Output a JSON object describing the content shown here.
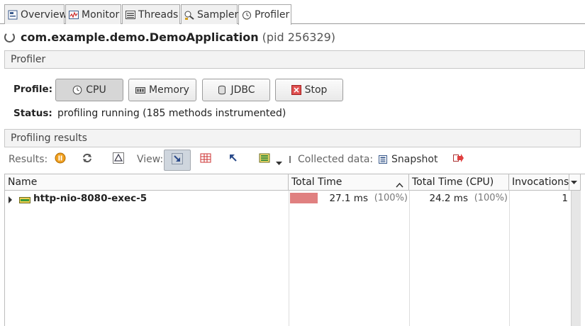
{
  "tabs": [
    {
      "label": "Overview",
      "icon": "overview-icon"
    },
    {
      "label": "Monitor",
      "icon": "monitor-icon"
    },
    {
      "label": "Threads",
      "icon": "threads-icon"
    },
    {
      "label": "Sampler",
      "icon": "sampler-icon"
    },
    {
      "label": "Profiler",
      "icon": "profiler-icon",
      "active": true
    }
  ],
  "app": {
    "name": "com.example.demo.DemoApplication",
    "pid": "(pid 256329)"
  },
  "profiler_section": {
    "title": "Profiler"
  },
  "profile": {
    "label": "Profile:",
    "buttons": {
      "cpu": "CPU",
      "memory": "Memory",
      "jdbc": "JDBC",
      "stop": "Stop"
    }
  },
  "status": {
    "label": "Status:",
    "value": "profiling running (185 methods instrumented)"
  },
  "results_section": {
    "title": "Profiling results"
  },
  "toolbar": {
    "results_label": "Results:",
    "view_label": "View:",
    "collected_label": "Collected data:",
    "snapshot_label": "Snapshot"
  },
  "table": {
    "columns": [
      "Name",
      "Total Time",
      "Total Time (CPU)",
      "Invocations"
    ],
    "rows": [
      {
        "name": "http-nio-8080-exec-5",
        "total_time": "27.1 ms",
        "total_pct": "(100%)",
        "total_bar_fraction": 0.42,
        "cpu_time": "24.2 ms",
        "cpu_pct": "(100%)",
        "invocations": "1"
      }
    ]
  },
  "colors": {
    "accent_bar": "#e08080",
    "tab_border": "#a8a8a8"
  }
}
